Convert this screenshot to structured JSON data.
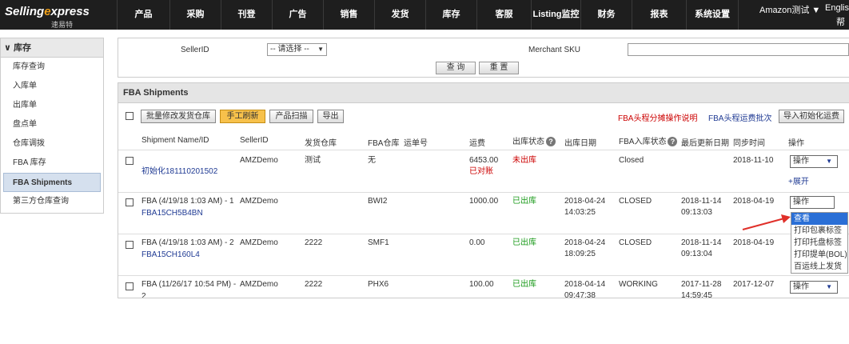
{
  "brand": {
    "name_part1": "Selling",
    "name_part2": "xpress",
    "name_e": "e",
    "sub": "速易特"
  },
  "nav": {
    "items": [
      "产品",
      "采购",
      "刊登",
      "广告",
      "销售",
      "发货",
      "库存",
      "客服",
      "Listing监控",
      "财务",
      "报表",
      "系统设置"
    ],
    "account": "Amazon测试 ▼",
    "lang": "Englis",
    "help": "帮"
  },
  "sidebar": {
    "header": "库存",
    "items": [
      "库存查询",
      "入库单",
      "出库单",
      "盘点单",
      "仓库调拨",
      "FBA 库存",
      "FBA Shipments",
      "第三方仓库查询"
    ],
    "active_index": 6
  },
  "search": {
    "seller_label": "SellerID",
    "seller_value": "-- 请选择 --",
    "sku_label": "Merchant SKU",
    "sku_value": "",
    "query_btn": "查 询",
    "reset_btn": "重 置"
  },
  "fba": {
    "title": "FBA Shipments",
    "toolbar": {
      "batch_btn": "批量修改发货仓库",
      "refresh_btn": "手工刷新",
      "scan_btn": "产品扫描",
      "export_btn": "导出",
      "red_link": "FBA头程分摊操作说明",
      "blue_link": "FBA头程运费批次",
      "import_btn": "导入初始化运费"
    },
    "columns": [
      "Shipment Name/ID",
      "SellerID",
      "发货仓库",
      "FBA仓库",
      "运单号",
      "运费",
      "出库状态",
      "出库日期",
      "FBA入库状态",
      "最后更新日期",
      "同步时间",
      "操作"
    ],
    "rows": [
      {
        "name": "",
        "id": "初始化181110201502",
        "seller": "AMZDemo",
        "warehouse": "测试",
        "fba_wh": "无",
        "freight": "6453.00",
        "freight_note": "已对账",
        "out_status": "未出库",
        "out_date": "",
        "out_time": "",
        "fba_status": "Closed",
        "update_date": "",
        "update_time": "",
        "sync": "2018-11-10",
        "op": "操作",
        "expand": "+展开"
      },
      {
        "name": "FBA (4/19/18 1:03 AM) - 1",
        "id": "FBA15CH5B4BN",
        "seller": "AMZDemo",
        "warehouse": "",
        "fba_wh": "BWI2",
        "freight": "1000.00",
        "freight_note": "",
        "out_status": "已出库",
        "out_date": "2018-04-24",
        "out_time": "14:03:25",
        "fba_status": "CLOSED",
        "update_date": "2018-11-14",
        "update_time": "09:13:03",
        "sync": "2018-04-19",
        "op": "操作",
        "expand": ""
      },
      {
        "name": "FBA (4/19/18 1:03 AM) - 2",
        "id": "FBA15CH160L4",
        "seller": "AMZDemo",
        "warehouse": "2222",
        "fba_wh": "SMF1",
        "freight": "0.00",
        "freight_note": "",
        "out_status": "已出库",
        "out_date": "2018-04-24",
        "out_time": "18:09:25",
        "fba_status": "CLOSED",
        "update_date": "2018-11-14",
        "update_time": "09:13:04",
        "sync": "2018-04-19",
        "op": "",
        "expand": ""
      },
      {
        "name": "FBA (11/26/17 10:54 PM) -",
        "id": "2",
        "seller": "AMZDemo",
        "warehouse": "2222",
        "fba_wh": "PHX6",
        "freight": "100.00",
        "freight_note": "",
        "out_status": "已出库",
        "out_date": "2018-04-14",
        "out_time": "09:47:38",
        "fba_status": "WORKING",
        "update_date": "2017-11-28",
        "update_time": "14:59:45",
        "sync": "2017-12-07",
        "op": "操作",
        "expand": ""
      }
    ],
    "dropdown": [
      "查看",
      "打印包裹标签",
      "打印托盘标签",
      "打印提单(BOL)",
      "百运线上发货"
    ],
    "dropdown_highlight": 0
  },
  "colors": {
    "nav_bg": "#1e1e1e",
    "accent_orange": "#f0a019",
    "link_blue": "#1f3a93",
    "red": "#cc0000",
    "green": "#1a9a1a",
    "highlight": "#2a6fd6"
  }
}
